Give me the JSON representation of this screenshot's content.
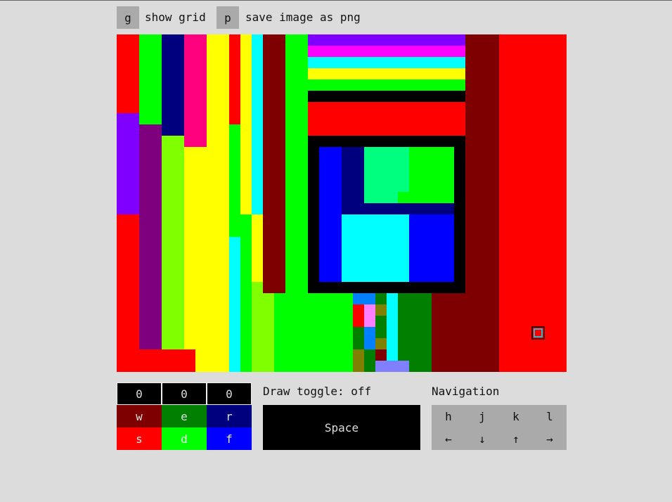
{
  "toolbar": {
    "grid_key": "g",
    "grid_label": "show grid",
    "save_key": "p",
    "save_label": "save image as png"
  },
  "palette": {
    "values": [
      "0",
      "0",
      "0"
    ],
    "keys": [
      {
        "key": "w",
        "color": "#7f0000"
      },
      {
        "key": "e",
        "color": "#007f00"
      },
      {
        "key": "r",
        "color": "#00007f"
      },
      {
        "key": "s",
        "color": "#ff0000"
      },
      {
        "key": "d",
        "color": "#00ff00"
      },
      {
        "key": "f",
        "color": "#0000ff"
      }
    ]
  },
  "draw": {
    "label": "Draw toggle: off",
    "space_label": "Space"
  },
  "navigation": {
    "title": "Navigation",
    "keys": [
      "h",
      "j",
      "k",
      "l"
    ],
    "arrows": [
      "←",
      "↓",
      "↑",
      "→"
    ]
  }
}
